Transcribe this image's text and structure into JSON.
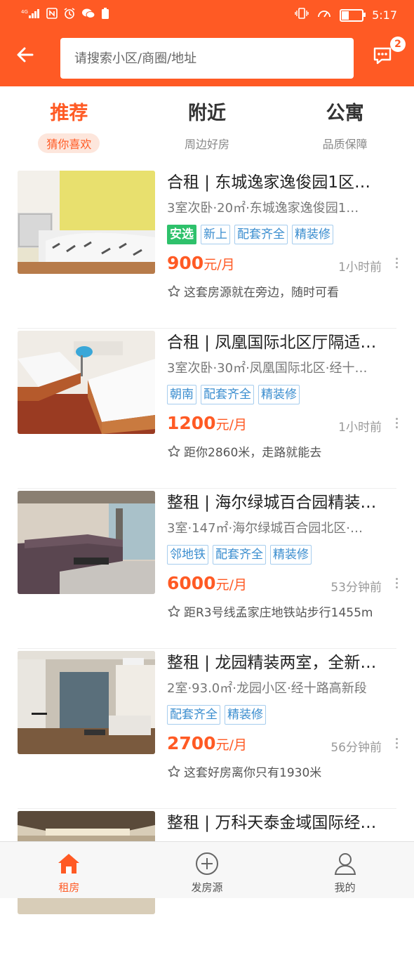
{
  "status_bar": {
    "network": "4G",
    "time": "5:17"
  },
  "search": {
    "placeholder": "请搜索小区/商圈/地址",
    "message_count": "2"
  },
  "tabs": [
    {
      "title": "推荐",
      "subtitle": "猜你喜欢",
      "active": true
    },
    {
      "title": "附近",
      "subtitle": "周边好房",
      "active": false
    },
    {
      "title": "公寓",
      "subtitle": "品质保障",
      "active": false
    }
  ],
  "listings": [
    {
      "title": "合租 | 东城逸家逸俊园1区…",
      "subtitle": "3室次卧·20㎡·东城逸家逸俊园1…",
      "tags": [
        "安选",
        "新上",
        "配套齐全",
        "精装修"
      ],
      "price": "900",
      "unit": "元/月",
      "time": "1小时前",
      "note": "这套房源就在旁边，随时可看"
    },
    {
      "title": "合租 | 凤凰国际北区厅隔适…",
      "subtitle": "3室次卧·30㎡·凤凰国际北区·经十…",
      "tags": [
        "朝南",
        "配套齐全",
        "精装修"
      ],
      "price": "1200",
      "unit": "元/月",
      "time": "1小时前",
      "note": "距你2860米，走路就能去"
    },
    {
      "title": "整租 | 海尔绿城百合园精装…",
      "subtitle": "3室·147㎡·海尔绿城百合园北区·…",
      "tags": [
        "邻地铁",
        "配套齐全",
        "精装修"
      ],
      "price": "6000",
      "unit": "元/月",
      "time": "53分钟前",
      "note": "距R3号线孟家庄地铁站步行1455m"
    },
    {
      "title": "整租 | 龙园精装两室，全新…",
      "subtitle": "2室·93.0㎡·龙园小区·经十路高新段",
      "tags": [
        "配套齐全",
        "精装修"
      ],
      "price": "2700",
      "unit": "元/月",
      "time": "56分钟前",
      "note": "这套好房离你只有1930米"
    },
    {
      "title": "整租 | 万科天泰金域国际经…",
      "subtitle": "",
      "tags": [],
      "price": "",
      "unit": "",
      "time": "",
      "note": ""
    }
  ],
  "bottom_nav": [
    {
      "label": "租房",
      "icon": "home-icon",
      "active": true
    },
    {
      "label": "发房源",
      "icon": "plus-circle-icon",
      "active": false
    },
    {
      "label": "我的",
      "icon": "user-icon",
      "active": false
    }
  ],
  "colors": {
    "accent": "#ff5a24",
    "tag_blue": "#3a8dcf",
    "tag_green": "#2ec16b"
  }
}
